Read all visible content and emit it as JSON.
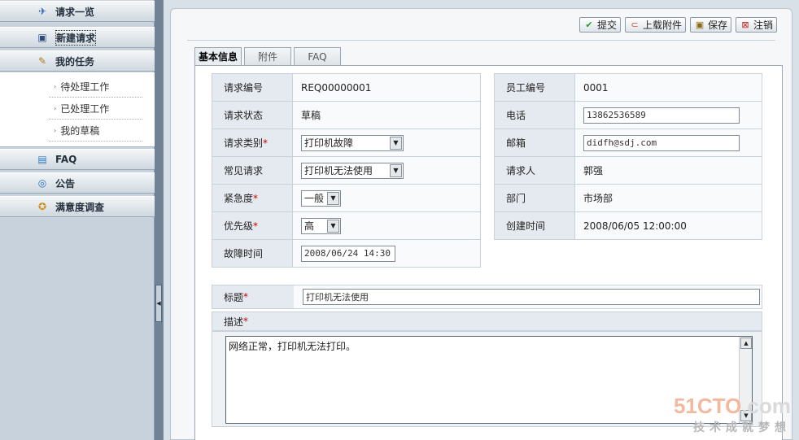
{
  "sidebar": {
    "items": [
      {
        "label": "请求一览",
        "icon": "request-list-icon",
        "glyph": "✈"
      },
      {
        "label": "新建请求",
        "icon": "new-request-icon",
        "glyph": "▣"
      },
      {
        "label": "我的任务",
        "icon": "my-tasks-icon",
        "glyph": "✎"
      },
      {
        "label": "FAQ",
        "icon": "faq-icon",
        "glyph": "📘"
      },
      {
        "label": "公告",
        "icon": "announcement-icon",
        "glyph": "◎"
      },
      {
        "label": "满意度调查",
        "icon": "survey-icon",
        "glyph": "✪"
      }
    ],
    "tasks": [
      {
        "label": "待处理工作"
      },
      {
        "label": "已处理工作"
      },
      {
        "label": "我的草稿"
      }
    ]
  },
  "toolbar": {
    "submit": "提交",
    "upload": "上载附件",
    "save": "保存",
    "cancel": "注销"
  },
  "tabs": [
    "基本信息",
    "附件",
    "FAQ"
  ],
  "form": {
    "request_no_label": "请求编号",
    "request_no": "REQ00000001",
    "status_label": "请求状态",
    "status": "草稿",
    "category_label": "请求类别",
    "category": "打印机故障",
    "common_label": "常见请求",
    "common": "打印机无法使用",
    "urgency_label": "紧急度",
    "urgency": "一般",
    "priority_label": "优先级",
    "priority": "高",
    "fault_time_label": "故障时间",
    "fault_time": "2008/06/24 14:30",
    "emp_no_label": "员工编号",
    "emp_no": "0001",
    "phone_label": "电话",
    "phone": "13862536589",
    "email_label": "邮箱",
    "email": "didfh@sdj.com",
    "requester_label": "请求人",
    "requester": "郭强",
    "dept_label": "部门",
    "dept": "市场部",
    "created_label": "创建时间",
    "created": "2008/06/05 12:00:00",
    "title_label": "标题",
    "title": "打印机无法使用",
    "desc_label": "描述",
    "desc": "网络正常，打印机无法打印。",
    "required_mark": "*"
  },
  "watermark": {
    "line1_a": "51CTO",
    "line1_b": ".com",
    "line2": "技术成就梦想"
  },
  "colors": {
    "required": "#cc0000",
    "sidebar_bg": "#c7d2dc"
  }
}
